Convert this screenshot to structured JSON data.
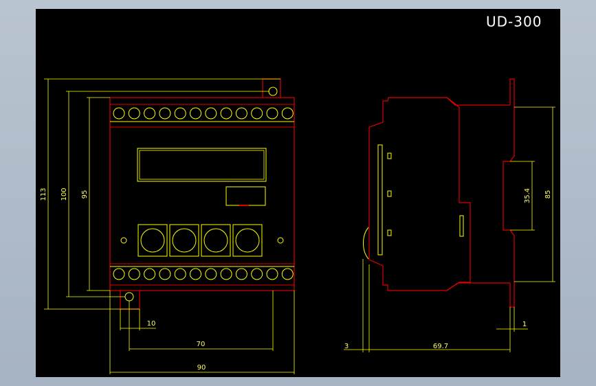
{
  "drawing": {
    "title": "UD-300",
    "colors": {
      "background": "#000000",
      "outline": "#e00000",
      "detail": "#ffff00",
      "dimension": "#ffff66",
      "title": "#ffffff",
      "frame": "#a9b5c3"
    },
    "front_view": {
      "dimensions": {
        "height_overall": "113",
        "height_mount": "100",
        "height_body": "95",
        "hole_offset": "10",
        "hole_pitch": "70",
        "width": "90"
      },
      "terminal_count_per_row": 12,
      "round_buttons": 4
    },
    "side_view": {
      "dimensions": {
        "rail": "35.4",
        "height": "85",
        "front_offset": "3",
        "depth": "69.7",
        "clip_thickness": "1"
      }
    }
  }
}
